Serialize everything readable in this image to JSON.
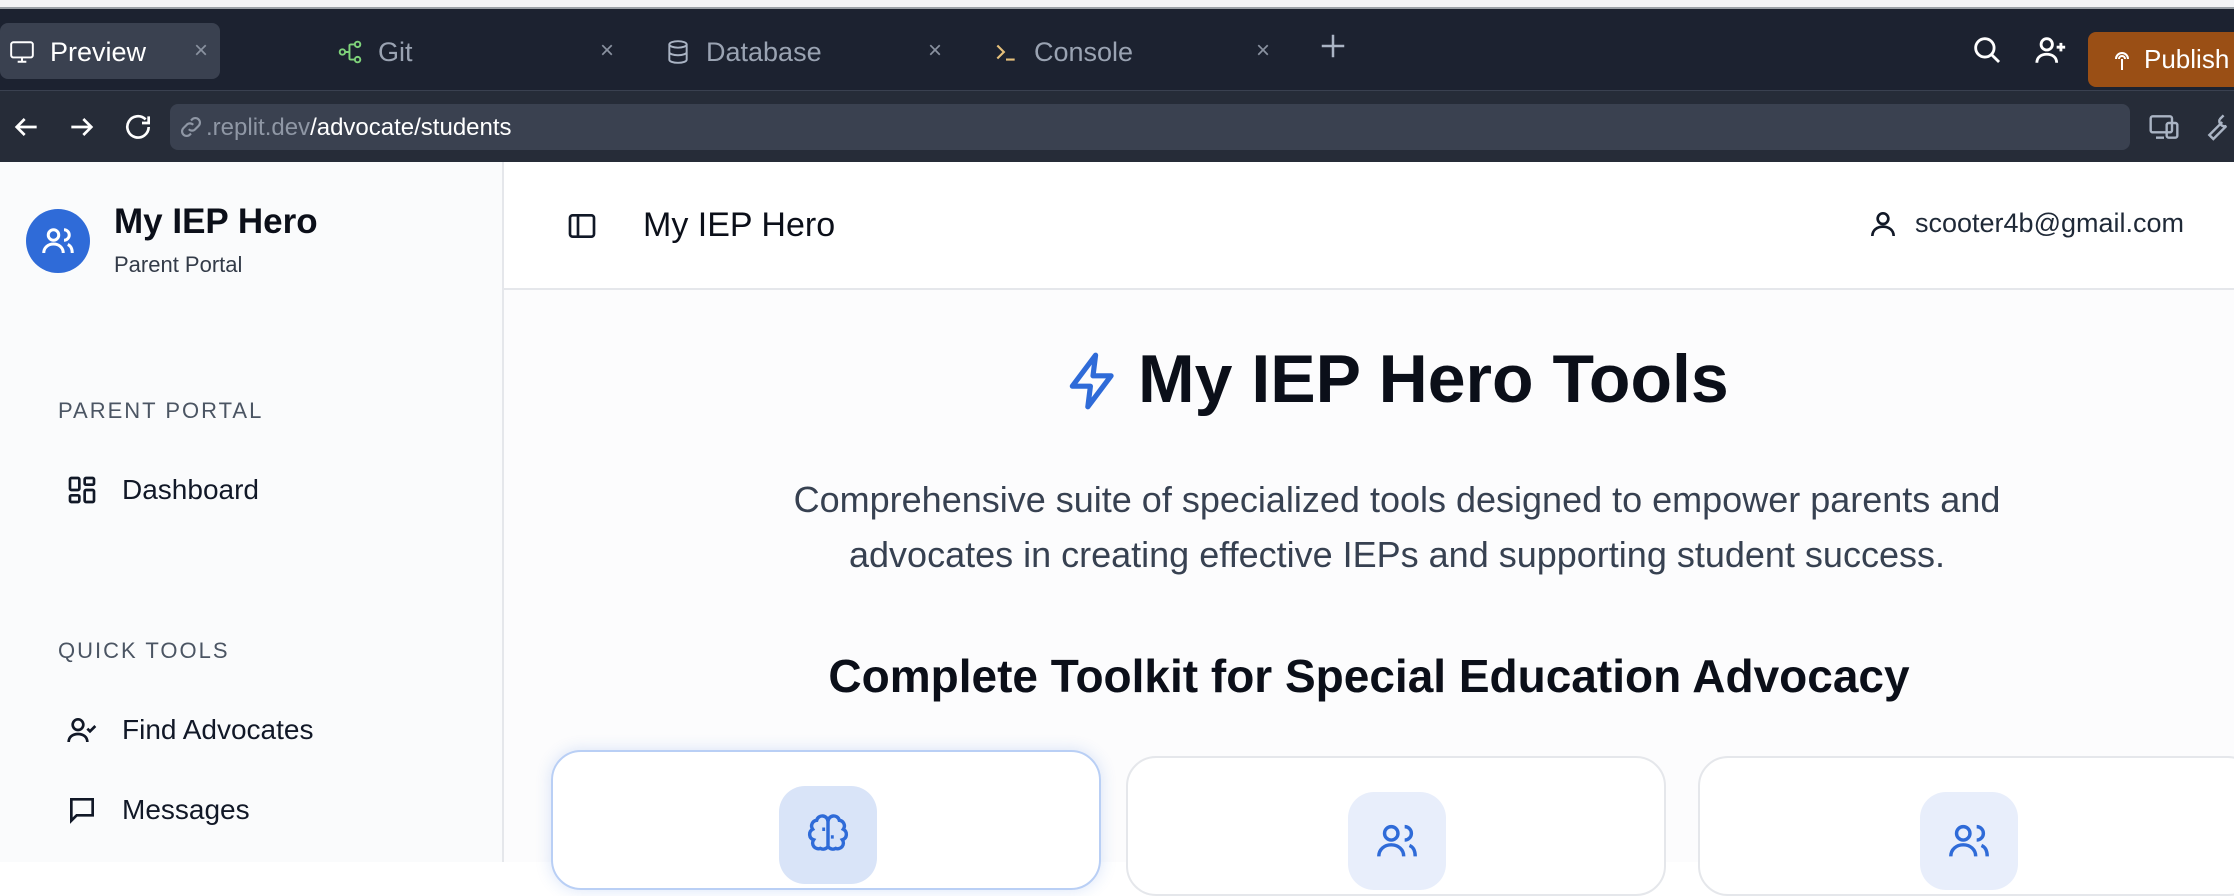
{
  "browser": {
    "tabs": [
      {
        "label": "Preview",
        "active": true,
        "icon": "monitor-icon"
      },
      {
        "label": "Git",
        "active": false,
        "icon": "git-branch-icon"
      },
      {
        "label": "Database",
        "active": false,
        "icon": "database-icon"
      },
      {
        "label": "Console",
        "active": false,
        "icon": "terminal-icon"
      }
    ],
    "close_glyph": "×",
    "publish_label": "Publish",
    "url_host": ".replit.dev",
    "url_path": "/advocate/students"
  },
  "sidebar": {
    "app_title": "My IEP Hero",
    "app_subtitle": "Parent Portal",
    "sections": [
      {
        "label": "PARENT PORTAL",
        "items": [
          {
            "label": "Dashboard",
            "icon": "dashboard-icon"
          }
        ]
      },
      {
        "label": "QUICK TOOLS",
        "items": [
          {
            "label": "Find Advocates",
            "icon": "user-check-icon"
          },
          {
            "label": "Messages",
            "icon": "message-icon"
          }
        ]
      }
    ]
  },
  "header": {
    "title": "My IEP Hero",
    "user_email": "scooter4b@gmail.com"
  },
  "main": {
    "hero_title": "My IEP Hero Tools",
    "description_line1": "Comprehensive suite of specialized tools designed to empower parents and",
    "description_line2": "advocates in creating effective IEPs and supporting student success.",
    "toolkit_heading": "Complete Toolkit for Special Education Advocacy",
    "cards": [
      {
        "icon": "brain-icon",
        "selected": true
      },
      {
        "icon": "users-icon",
        "selected": false
      },
      {
        "icon": "users-icon",
        "selected": false
      }
    ]
  },
  "colors": {
    "accent": "#2f6bd8",
    "publish": "#9a4f15",
    "tabbar": "#1c2230"
  }
}
